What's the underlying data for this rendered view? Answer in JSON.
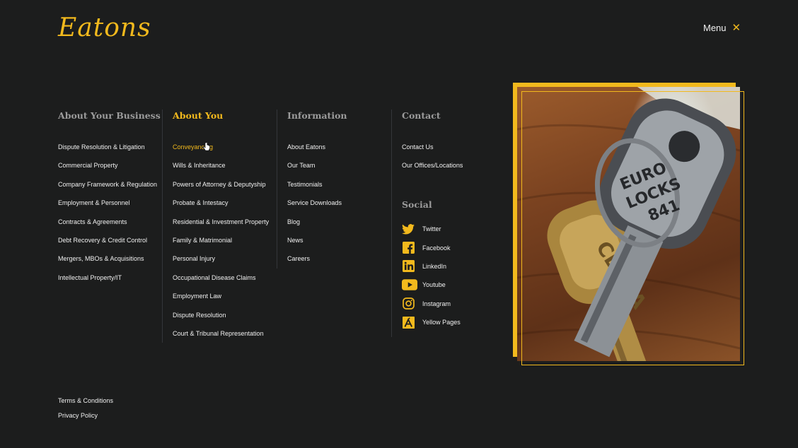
{
  "brand": {
    "logo_text": "Eatons",
    "accent_color": "#f2b91d"
  },
  "header": {
    "menu_label": "Menu",
    "close_icon": "close-icon"
  },
  "columns": [
    {
      "heading": "About Your Business",
      "items": [
        "Dispute Resolution & Litigation",
        "Commercial Property",
        "Company Framework & Regulation",
        "Employment & Personnel",
        "Contracts & Agreements",
        "Debt Recovery & Credit Control",
        "Mergers, MBOs & Acquisitions",
        "Intellectual Property/IT"
      ]
    },
    {
      "heading": "About You",
      "items": [
        "Conveyancing",
        "Wills & Inheritance",
        "Powers of Attorney & Deputyship",
        "Probate & Intestacy",
        "Residential & Investment Property",
        "Family & Matrimonial",
        "Personal Injury",
        "Occupational Disease Claims",
        "Employment Law",
        "Dispute Resolution",
        "Court & Tribunal Representation"
      ]
    },
    {
      "heading": "Information",
      "items": [
        "About Eatons",
        "Our Team",
        "Testimonials",
        "Service Downloads",
        "Blog",
        "News",
        "Careers"
      ]
    },
    {
      "heading": "Contact",
      "items": [
        "Contact Us",
        "Our Offices/Locations"
      ]
    }
  ],
  "social": {
    "heading": "Social",
    "items": [
      {
        "label": "Twitter",
        "icon": "twitter-icon"
      },
      {
        "label": "Facebook",
        "icon": "facebook-icon"
      },
      {
        "label": "LinkedIn",
        "icon": "linkedin-icon"
      },
      {
        "label": "Youtube",
        "icon": "youtube-icon"
      },
      {
        "label": "Instagram",
        "icon": "instagram-icon"
      },
      {
        "label": "Yellow Pages",
        "icon": "yellow-pages-icon"
      }
    ]
  },
  "image": {
    "key1_line1": "EURO",
    "key1_line2": "LOCKS",
    "key1_line3": "841",
    "key2_text": "CERDA"
  },
  "footer": {
    "links": [
      "Terms & Conditions",
      "Privacy Policy"
    ]
  }
}
